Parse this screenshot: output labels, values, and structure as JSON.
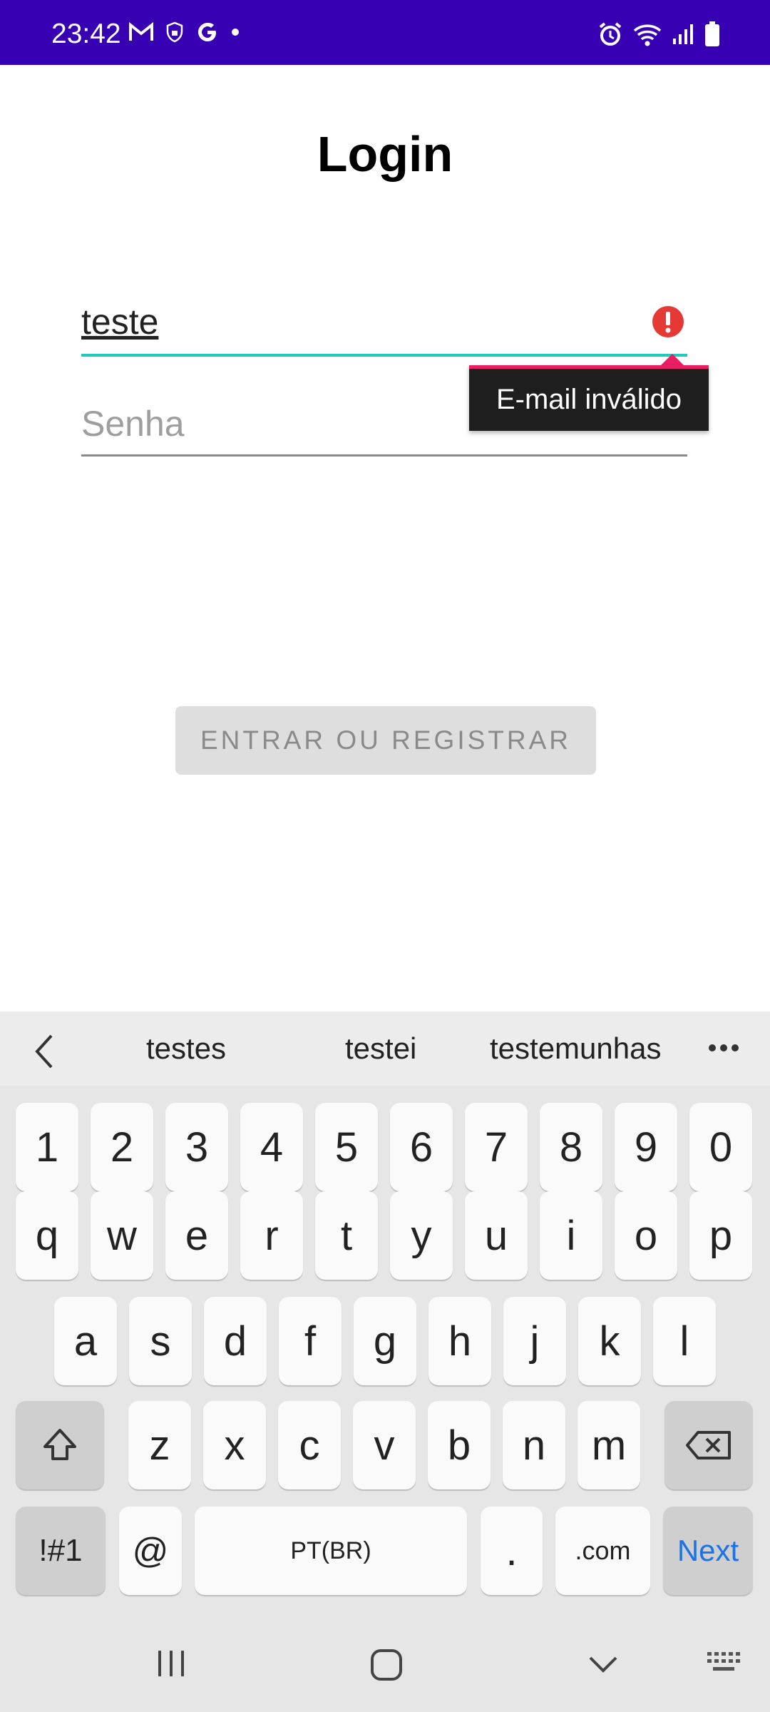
{
  "status_bar": {
    "time": "23:42",
    "left_icons": [
      "gmail-icon",
      "vpn-shield-icon",
      "google-icon",
      "dot-icon"
    ],
    "right_icons": [
      "alarm-icon",
      "wifi-icon",
      "signal-icon",
      "battery-icon"
    ]
  },
  "page": {
    "title": "Login"
  },
  "email_field": {
    "value": "teste",
    "error_message": "E-mail inválido"
  },
  "password_field": {
    "placeholder": "Senha",
    "value": ""
  },
  "submit_button": {
    "label": "ENTRAR OU REGISTRAR"
  },
  "keyboard": {
    "suggestions": [
      "testes",
      "testei",
      "testemunhas"
    ],
    "row_numbers": [
      "1",
      "2",
      "3",
      "4",
      "5",
      "6",
      "7",
      "8",
      "9",
      "0"
    ],
    "row_top": [
      "q",
      "w",
      "e",
      "r",
      "t",
      "y",
      "u",
      "i",
      "o",
      "p"
    ],
    "row_middle": [
      "a",
      "s",
      "d",
      "f",
      "g",
      "h",
      "j",
      "k",
      "l"
    ],
    "row_bottom": [
      "z",
      "x",
      "c",
      "v",
      "b",
      "n",
      "m"
    ],
    "symbols_label": "!#1",
    "at_label": "@",
    "space_label": "PT(BR)",
    "period_label": ".",
    "dotcom_label": ".com",
    "next_label": "Next"
  },
  "colors": {
    "status_bar": "#3700b3",
    "field_focus": "#1ccbbd",
    "error": "#e53935",
    "accent_next": "#1a73e8"
  }
}
